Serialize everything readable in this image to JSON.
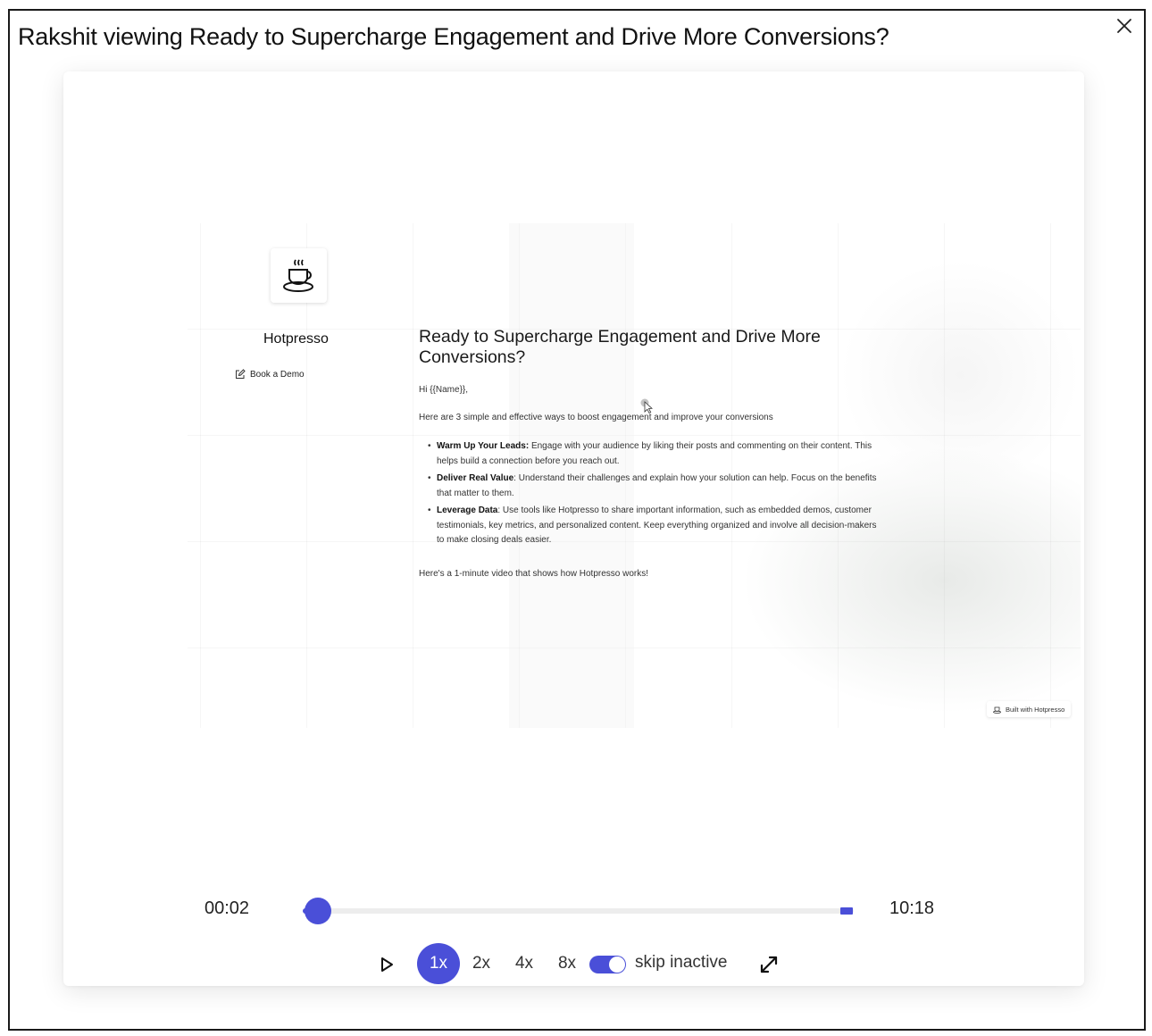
{
  "modal": {
    "title": "Rakshit viewing Ready to Supercharge Engagement and Drive More Conversions?",
    "close_icon": "close-icon"
  },
  "replay": {
    "brand": {
      "name": "Hotpresso",
      "logo_icon": "coffee-cup-icon",
      "book_demo_label": "Book a Demo",
      "book_demo_icon": "edit-icon"
    },
    "article": {
      "heading": "Ready to Supercharge Engagement and Drive More Conversions?",
      "greeting": "Hi {{Name}},",
      "intro": "Here are 3 simple and effective ways to boost engagement and improve your conversions",
      "points": [
        {
          "title": "Warm Up Your Leads:",
          "text": " Engage with your audience by liking their posts and commenting on their content. This helps build a connection before you reach out."
        },
        {
          "title": "Deliver Real Value",
          "text": ": Understand their challenges and explain how your solution can help. Focus on the benefits that matter to them."
        },
        {
          "title": "Leverage Data",
          "text": ": Use tools like Hotpresso to share important information, such as embedded demos, customer testimonials, key metrics, and personalized content. Keep everything organized and involve all decision-makers to make closing deals easier."
        }
      ],
      "closing": "Here's a 1-minute video that shows how Hotpresso works!"
    },
    "built_with_label": "Built with Hotpresso"
  },
  "player": {
    "current_time": "00:02",
    "total_time": "10:18",
    "progress": 0.003,
    "speeds": [
      "1x",
      "2x",
      "4x",
      "8x"
    ],
    "active_speed": "1x",
    "skip_inactive_label": "skip inactive",
    "skip_inactive_on": true,
    "accent_color": "#4a4fd8"
  }
}
